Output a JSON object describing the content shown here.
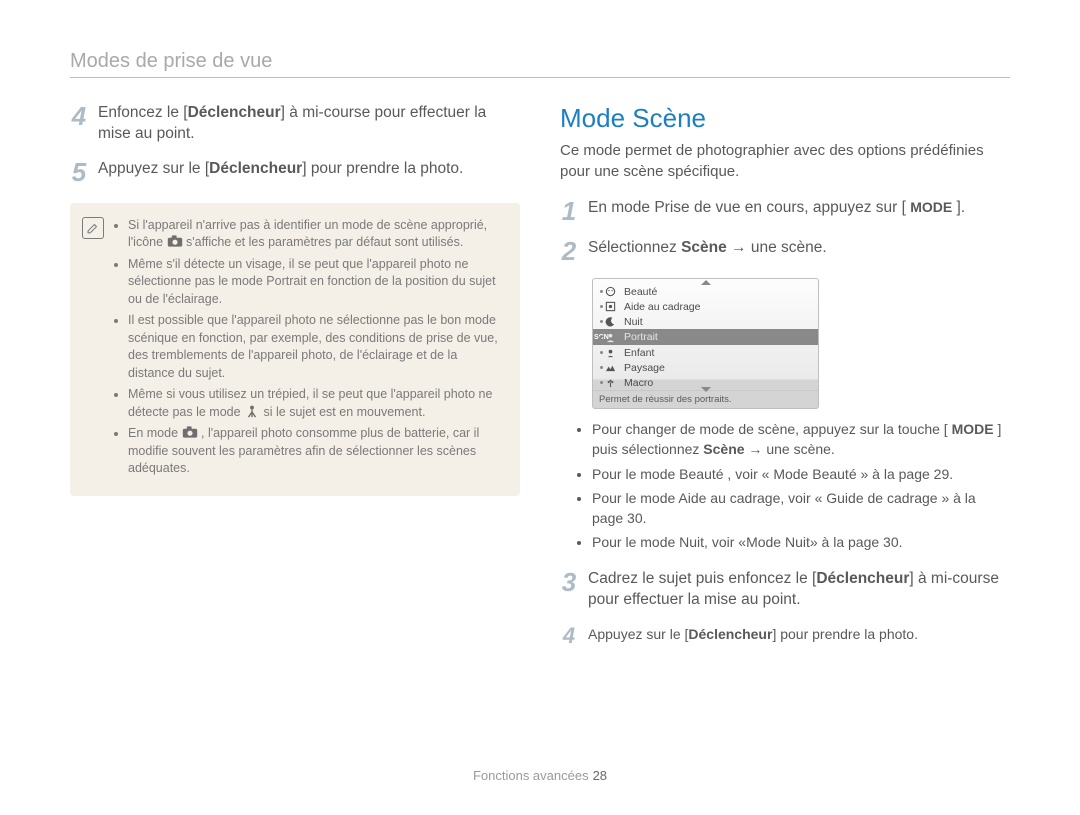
{
  "page": {
    "header": "Modes de prise de vue",
    "footer_label": "Fonctions avancées",
    "footer_page": "28"
  },
  "left": {
    "step4_num": "4",
    "step4_pre": "Enfoncez le [",
    "step4_bold": "Déclencheur",
    "step4_post": "] à mi-course pour effectuer la mise au point.",
    "step5_num": "5",
    "step5_pre": "Appuyez sur le [",
    "step5_bold": "Déclencheur",
    "step5_post": "] pour prendre la photo.",
    "note_icon": "✎",
    "notes": {
      "n1a": "Si l'appareil n'arrive pas à identifier un mode de scène approprié, l'icône ",
      "n1b": " s'affiche et les paramètres par défaut sont utilisés.",
      "n2": "Même s'il détecte un visage, il se peut que l'appareil photo ne sélectionne pas le mode Portrait en fonction de la position du sujet ou de l'éclairage.",
      "n3": "Il est possible que l'appareil photo ne sélectionne pas le bon mode scénique en fonction, par exemple, des conditions de prise de vue, des tremblements de l'appareil photo, de l'éclairage et de la distance du sujet.",
      "n4a": "Même si vous utilisez un trépied, il se peut que l'appareil photo ne détecte pas le mode ",
      "n4b": " si le sujet est en mouvement.",
      "n5a": "En mode ",
      "n5b": " , l'appareil photo consomme plus de batterie, car il modifie souvent les paramètres afin de sélectionner les scènes adéquates."
    }
  },
  "right": {
    "title": "Mode Scène",
    "intro": "Ce mode permet de photographier avec des options prédéfinies pour une scène spécifique.",
    "step1_num": "1",
    "step1_pre": "En mode Prise de vue en cours, appuyez sur [ ",
    "step1_mode": "MODE",
    "step1_post": " ].",
    "step2_num": "2",
    "step2_pre": "Sélectionnez ",
    "step2_bold": "Scène",
    "step2_post": " → une scène.",
    "menu": {
      "items": [
        "Beauté",
        "Aide au cadrage",
        "Nuit",
        "Portrait",
        "Enfant",
        "Paysage",
        "Macro"
      ],
      "selected": "Portrait",
      "scn_label": "SCN",
      "tooltip": "Permet de réussir des portraits."
    },
    "bullets": {
      "b1_pre": "Pour changer de mode de scène, appuyez sur la touche [ ",
      "b1_mode": "MODE",
      "b1_mid": " ] puis sélectionnez ",
      "b1_bold": "Scène",
      "b1_post": " → une scène.",
      "b2": "Pour le mode  Beauté , voir « Mode Beauté » à la page 29.",
      "b3": "Pour le mode Aide au cadrage, voir « Guide de cadrage » à la page 30.",
      "b4": "Pour le mode Nuit, voir «Mode Nuit» à la page 30."
    },
    "step3_num": "3",
    "step3_pre": "Cadrez le sujet puis enfoncez le [",
    "step3_bold": "Déclencheur",
    "step3_post": "] à mi-course pour effectuer la mise au point.",
    "step4_num": "4",
    "step4_pre": "Appuyez sur le [",
    "step4_bold": "Déclencheur",
    "step4_post": "] pour prendre la photo."
  }
}
